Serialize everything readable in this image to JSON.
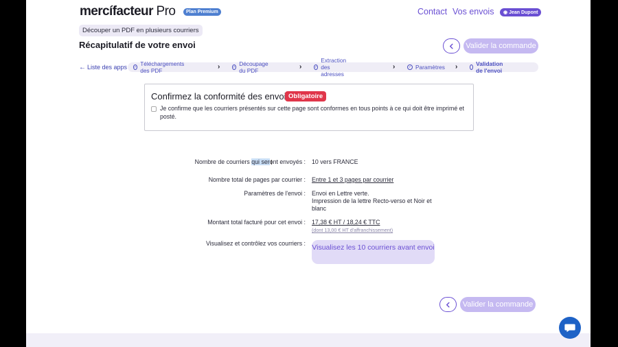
{
  "header": {
    "logo_part1": "mercí",
    "logo_part2": "facteur",
    "logo_part3": "Pro",
    "plan_badge": "Plan Premium",
    "nav_contact": "Contact",
    "nav_envois": "Vos envois",
    "user_name": "Jean Dupont",
    "user_icon": "user-icon"
  },
  "breadcrumb_pill": "Découper un PDF en plusieurs courriers",
  "page_title": "Récapitulatif de votre envoi",
  "top_actions": {
    "back_icon": "chevron-left-icon",
    "validate_label": "Valider la commande"
  },
  "steps": {
    "apps_link": "Liste des apps",
    "items": [
      {
        "label": "Téléchargements des PDF",
        "state": "done"
      },
      {
        "label": "Découpage du PDF",
        "state": "done"
      },
      {
        "label": "Extraction des adresses",
        "state": "done"
      },
      {
        "label": "Paramètres",
        "state": "done"
      },
      {
        "label": "Validation de l'envoi",
        "state": "current"
      }
    ]
  },
  "confirm": {
    "title": "Confirmez la conformité des envois",
    "required_tag": "Obligatoire",
    "checkbox_label": "Je confirme que les courriers présentés sur cette page sont conformes en tous points à ce qui doit être imprimé et posté.",
    "checked": false
  },
  "summary": {
    "count_label_a": "Nombre de courriers ",
    "count_label_b": "qui ser",
    "count_label_c": "ont envoyés :",
    "count_value": "10 vers FRANCE",
    "pages_label": "Nombre total de pages par courrier :",
    "pages_value": "Entre 1 et 3 pages par courrier",
    "params_label": "Paramètres de l'envoi :",
    "params_line1": "Envoi en Lettre verte.",
    "params_line2": "Impression de la lettre Recto-verso et Noir et blanc",
    "amount_label": "Montant total facturé pour cet envoi :",
    "amount_value": "17,38 € HT / 18,24 € TTC",
    "amount_sub": "(dont 13,00 € HT d'affranchissement)",
    "preview_label": "Visualisez et contrôlez vos courriers :",
    "preview_button": "Visualisez les 10 courriers avant envoi"
  },
  "bottom_actions": {
    "back_icon": "chevron-left-icon",
    "validate_label": "Valider la commande"
  },
  "chat_icon": "chat-bubble-icon",
  "colors": {
    "accent": "#6a4fd3",
    "accent_light": "#c5b9f1",
    "required": "#e0364a",
    "plan_badge": "#4e7fd0",
    "chat": "#1e62c6"
  }
}
